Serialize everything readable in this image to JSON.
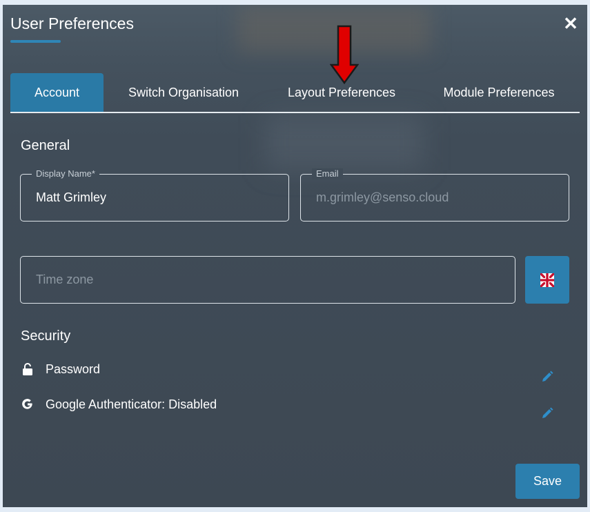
{
  "dialog": {
    "title": "User Preferences",
    "close_icon": "close-icon"
  },
  "tabs": [
    {
      "label": "Account",
      "active": true
    },
    {
      "label": "Switch Organisation",
      "active": false
    },
    {
      "label": "Layout Preferences",
      "active": false
    },
    {
      "label": "Module Preferences",
      "active": false
    }
  ],
  "annotation": {
    "icon": "red-down-arrow",
    "color": "#e00000"
  },
  "general": {
    "title": "General",
    "display_name": {
      "label": "Display Name*",
      "value": "Matt Grimley"
    },
    "email": {
      "label": "Email",
      "value": "m.grimley@senso.cloud"
    },
    "timezone": {
      "placeholder": "Time zone"
    },
    "language_icon": "uk-flag-icon"
  },
  "security": {
    "title": "Security",
    "items": [
      {
        "label": "Password",
        "icon": "unlock-icon",
        "edit_icon": "pencil-icon"
      },
      {
        "label": "Google Authenticator: Disabled",
        "icon": "google-icon",
        "edit_icon": "pencil-icon"
      }
    ]
  },
  "footer": {
    "save_label": "Save"
  },
  "colors": {
    "accent": "#2c7fae",
    "background": "#404c58",
    "text": "#ffffff"
  }
}
